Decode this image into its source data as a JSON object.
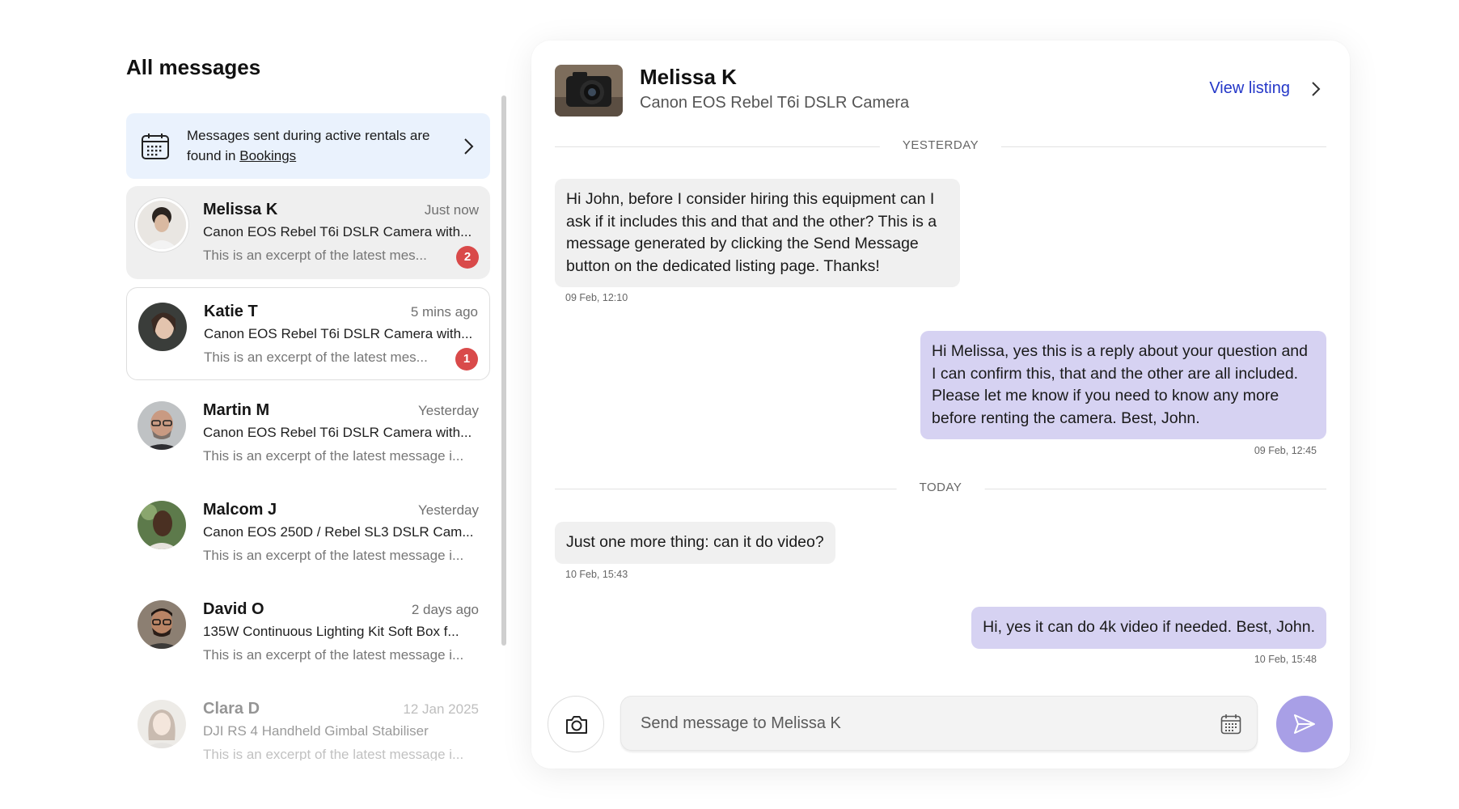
{
  "sidebar": {
    "title": "All messages",
    "notice": {
      "text": "Messages sent during active rentals are found in ",
      "link": "Bookings"
    },
    "conversations": [
      {
        "name": "Melissa K",
        "time": "Just now",
        "item": "Canon EOS Rebel T6i DSLR Camera with...",
        "excerpt": "This is an excerpt of the latest mes...",
        "unread": "2"
      },
      {
        "name": "Katie T",
        "time": "5 mins ago",
        "item": "Canon EOS Rebel T6i DSLR Camera with...",
        "excerpt": "This is an excerpt of the latest mes...",
        "unread": "1"
      },
      {
        "name": "Martin M",
        "time": "Yesterday",
        "item": "Canon EOS Rebel T6i DSLR Camera with...",
        "excerpt": "This is an excerpt of the latest message i..."
      },
      {
        "name": "Malcom J",
        "time": "Yesterday",
        "item": "Canon EOS 250D / Rebel SL3 DSLR Cam...",
        "excerpt": "This is an excerpt of the latest message i..."
      },
      {
        "name": "David O",
        "time": "2 days ago",
        "item": "135W Continuous Lighting Kit Soft Box f...",
        "excerpt": "This is an excerpt of the latest message i..."
      },
      {
        "name": "Clara D",
        "time": "12 Jan 2025",
        "item": "DJI RS 4 Handheld Gimbal Stabiliser",
        "excerpt": "This is an excerpt of the latest message i..."
      }
    ]
  },
  "chat": {
    "name": "Melissa K",
    "item": "Canon EOS Rebel T6i DSLR Camera",
    "view_listing": "View listing",
    "divider_yesterday": "YESTERDAY",
    "divider_today": "TODAY",
    "messages": [
      {
        "text": "Hi John, before I consider hiring this equipment can I ask if it includes this and that and the other? This is a message generated by clicking the Send Message button on the dedicated listing page. Thanks!",
        "time": "09 Feb, 12:10"
      },
      {
        "text": "Hi Melissa, yes this is a reply about your question and I can confirm this, that and the other are all included. Please let me know if you need to know any more before renting the camera. Best, John.",
        "time": "09 Feb, 12:45"
      },
      {
        "text": "Just one more thing: can it do video?",
        "time": "10 Feb, 15:43"
      },
      {
        "text": "Hi, yes it can do 4k video if needed. Best, John.",
        "time": "10 Feb, 15:48"
      }
    ],
    "input_placeholder": "Send message to Melissa K"
  },
  "colors": {
    "accent_link": "#2437c8",
    "outgoing_bubble": "#d6d2f2",
    "incoming_bubble": "#f0f0f0",
    "send_button": "#a89fe6",
    "unread_badge": "#d94a4a",
    "notice_bg": "#eaf2fd"
  },
  "icons": [
    "calendar-icon",
    "chevron-right-icon",
    "camera-icon",
    "send-icon"
  ]
}
